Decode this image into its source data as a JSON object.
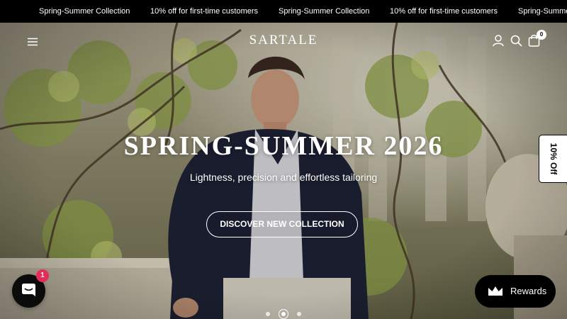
{
  "announcement": {
    "items": [
      "Spring-Summer Collection",
      "10% off for first-time customers",
      "Spring-Summer Collection",
      "10% off for first-time customers",
      "Spring-Summe"
    ]
  },
  "header": {
    "logo": "SARTALE",
    "menu_icon": "menu-icon",
    "account_icon": "account-icon",
    "search_icon": "search-icon",
    "cart_icon": "cart-icon",
    "cart_count": "0"
  },
  "hero": {
    "title": "SPRING-SUMMER 2026",
    "subtitle": "Lightness, precision and effortless tailoring",
    "button_label": "DISCOVER NEW COLLECTION",
    "slides_total": 3,
    "active_slide": 2
  },
  "promo_tab": {
    "label": "10% Off"
  },
  "chat": {
    "icon": "chat-icon",
    "badge": "1"
  },
  "rewards": {
    "label": "Rewards",
    "icon": "crown-icon"
  },
  "colors": {
    "accent_badge": "#e32c5a",
    "bar_bg": "#000000"
  }
}
